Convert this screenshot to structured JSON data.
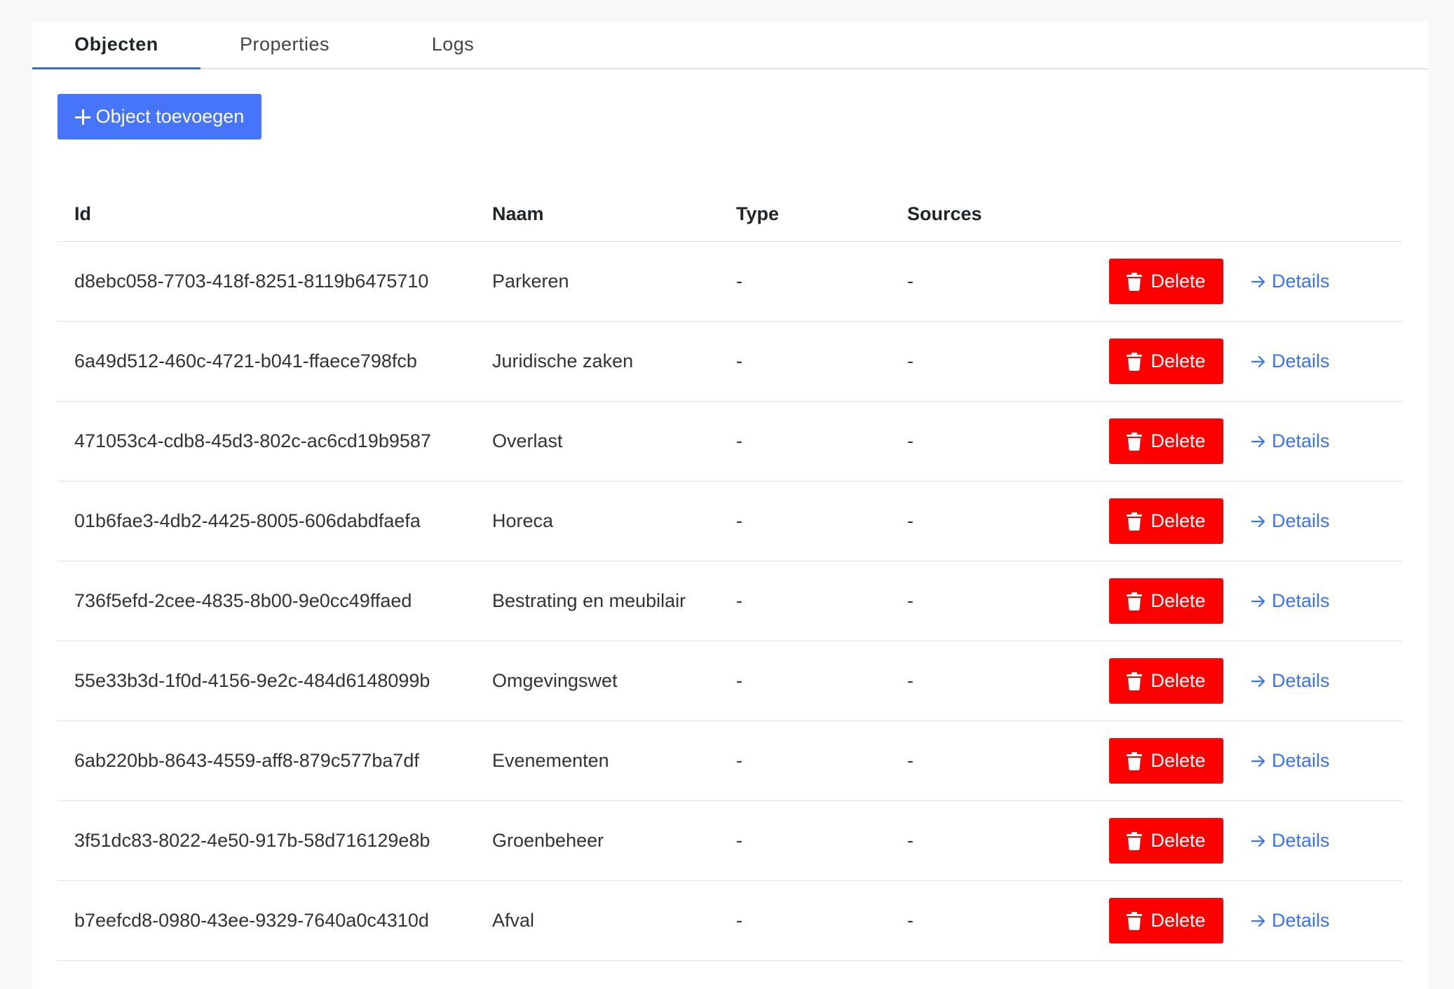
{
  "tabs": [
    {
      "label": "Objecten",
      "active": true
    },
    {
      "label": "Properties",
      "active": false
    },
    {
      "label": "Logs",
      "active": false
    }
  ],
  "add_button": {
    "label": "Object toevoegen",
    "icon": "plus-icon"
  },
  "table": {
    "headers": {
      "id": "Id",
      "naam": "Naam",
      "type": "Type",
      "sources": "Sources"
    },
    "delete_label": "Delete",
    "details_label": "Details",
    "rows": [
      {
        "id": "d8ebc058-7703-418f-8251-8119b6475710",
        "naam": "Parkeren",
        "type": "-",
        "sources": "-"
      },
      {
        "id": "6a49d512-460c-4721-b041-ffaece798fcb",
        "naam": "Juridische zaken",
        "type": "-",
        "sources": "-"
      },
      {
        "id": "471053c4-cdb8-45d3-802c-ac6cd19b9587",
        "naam": "Overlast",
        "type": "-",
        "sources": "-"
      },
      {
        "id": "01b6fae3-4db2-4425-8005-606dabdfaefa",
        "naam": "Horeca",
        "type": "-",
        "sources": "-"
      },
      {
        "id": "736f5efd-2cee-4835-8b00-9e0cc49ffaed",
        "naam": "Bestrating en meubilair",
        "type": "-",
        "sources": "-"
      },
      {
        "id": "55e33b3d-1f0d-4156-9e2c-484d6148099b",
        "naam": "Omgevingswet",
        "type": "-",
        "sources": "-"
      },
      {
        "id": "6ab220bb-8643-4559-aff8-879c577ba7df",
        "naam": "Evenementen",
        "type": "-",
        "sources": "-"
      },
      {
        "id": "3f51dc83-8022-4e50-917b-58d716129e8b",
        "naam": "Groenbeheer",
        "type": "-",
        "sources": "-"
      },
      {
        "id": "b7eefcd8-0980-43ee-9329-7640a0c4310d",
        "naam": "Afval",
        "type": "-",
        "sources": "-"
      }
    ]
  },
  "colors": {
    "primary": "#4775fa",
    "danger": "#ff0000",
    "link": "#3b73f0",
    "tab_underline": "#3572c7"
  }
}
